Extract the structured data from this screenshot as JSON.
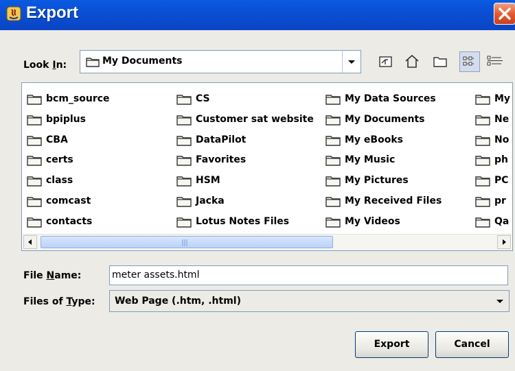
{
  "window": {
    "title": "Export",
    "close_icon": "close-icon"
  },
  "look_in": {
    "label_prefix": "Look ",
    "label_mnemonic": "I",
    "label_suffix": "n:",
    "value": "My Documents"
  },
  "toolbar": [
    "up-one-level-icon",
    "home-icon",
    "new-folder-icon",
    "list-view-icon",
    "details-view-icon"
  ],
  "files": [
    [
      "bcm_source",
      "bpiplus",
      "CBA",
      "certs",
      "class",
      "comcast",
      "contacts"
    ],
    [
      "CS",
      "Customer sat website",
      "DataPilot",
      "Favorites",
      "HSM",
      "Jacka",
      "Lotus Notes Files"
    ],
    [
      "My Data Sources",
      "My Documents",
      "My eBooks",
      "My Music",
      "My Pictures",
      "My Received Files",
      "My Videos"
    ],
    [
      "My",
      "Ne",
      "No",
      "ph",
      "PC",
      "pr",
      "Qa"
    ]
  ],
  "file_name": {
    "label_prefix": "File ",
    "label_mnemonic": "N",
    "label_suffix": "ame:",
    "value": "meter assets.html"
  },
  "files_of_type": {
    "label_prefix": "Files of ",
    "label_mnemonic": "T",
    "label_suffix": "ype:",
    "value": "Web Page (.htm, .html)"
  },
  "buttons": {
    "export": "Export",
    "cancel": "Cancel"
  },
  "colors": {
    "title_bar": "#0b4fd3",
    "dialog_bg": "#ecebe6",
    "close": "#e55b2f",
    "folder": "#f7f7f2"
  }
}
